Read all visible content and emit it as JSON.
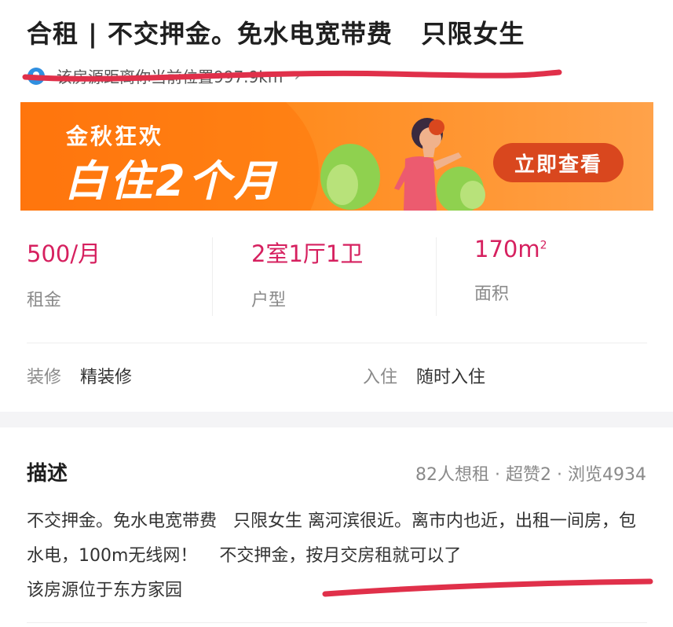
{
  "listing": {
    "title": "合租 | 不交押金。免水电宽带费   只限女生",
    "location_text": "该房源距离你当前位置997.9km"
  },
  "banner": {
    "line1": "金秋狂欢",
    "line2": "白住2个月",
    "cta_label": "立即查看"
  },
  "stats": [
    {
      "value": "500/月",
      "label": "租金"
    },
    {
      "value": "2室1厅1卫",
      "label": "户型"
    },
    {
      "value": "170m",
      "unit_sup": "2",
      "label": "面积"
    }
  ],
  "details": {
    "decoration_key": "装修",
    "decoration_value": "精装修",
    "move_in_key": "入住",
    "move_in_value": "随时入住"
  },
  "description": {
    "heading": "描述",
    "meta": "82人想租 · 超赞2 · 浏览4934",
    "body": "不交押金。免水电宽带费   只限女生 离河滨很近。离市内也近，出租一间房，包水电，100m无线网！    不交押金，按月交房租就可以了\n该房源位于东方家园"
  },
  "icons": {
    "location": "location-pin-icon",
    "chevron": "chevron-right-icon"
  },
  "colors": {
    "accent": "#d6205f",
    "banner": "#ff8c1f",
    "cta": "#d9471e",
    "annotation_stroke": "#e0304a"
  }
}
